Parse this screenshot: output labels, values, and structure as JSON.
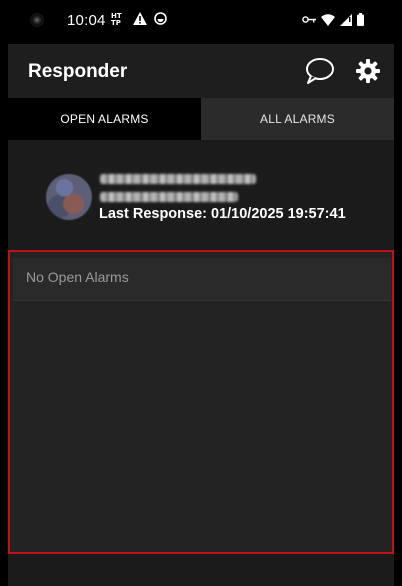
{
  "status_bar": {
    "time": "10:04",
    "left_icons": [
      "ht-badge-icon",
      "warning-icon",
      "app-circle-icon"
    ],
    "right_icons": [
      "vpn-key-icon",
      "wifi-icon",
      "signal-icon",
      "battery-icon"
    ]
  },
  "app_bar": {
    "title": "Responder",
    "actions": [
      "chat-icon",
      "gear-icon"
    ]
  },
  "tabs": [
    {
      "label": "OPEN ALARMS",
      "active": true
    },
    {
      "label": "ALL ALARMS",
      "active": false
    }
  ],
  "profile": {
    "last_response": "Last Response: 01/10/2025 19:57:41"
  },
  "alarms": {
    "empty_message": "No Open Alarms"
  },
  "colors": {
    "background": "#1b1b1b",
    "highlight_border": "#c0101a",
    "active_tab": "#000000",
    "inactive_tab": "#2b2b2b"
  }
}
